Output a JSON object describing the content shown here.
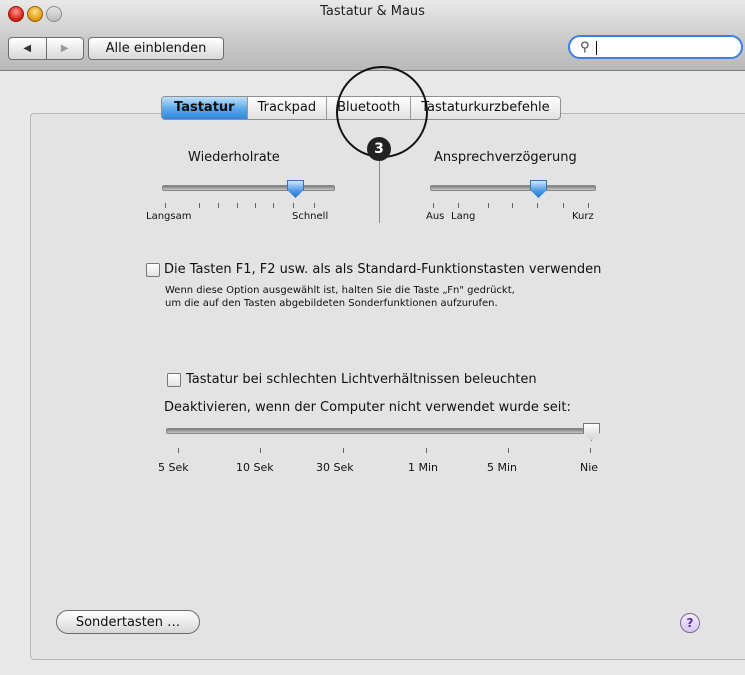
{
  "window": {
    "title": "Tastatur & Maus"
  },
  "toolbar": {
    "back_glyph": "◀",
    "forward_glyph": "▶",
    "show_all_label": "Alle einblenden",
    "search_icon_glyph": "⚲"
  },
  "tabs": [
    {
      "label": "Tastatur",
      "active": true
    },
    {
      "label": "Trackpad",
      "active": false
    },
    {
      "label": "Bluetooth",
      "active": false
    },
    {
      "label": "Tastaturkurzbefehle",
      "active": false
    }
  ],
  "keyboard": {
    "repeat_rate": {
      "title": "Wiederholrate",
      "min_label": "Langsam",
      "max_label": "Schnell"
    },
    "repeat_delay": {
      "title": "Ansprechverzögerung",
      "min_label": "Aus",
      "min_label2": "Lang",
      "max_label": "Kurz"
    },
    "fn_option": {
      "label": "Die Tasten F1, F2 usw. als als Standard-Funktionstasten verwenden",
      "help_line1": "Wenn diese Option ausgewählt ist, halten Sie die Taste „Fn\" gedrückt,",
      "help_line2": "um die auf den Tasten abgebildeten Sonderfunktionen aufzurufen.",
      "checked": false
    },
    "backlight": {
      "label": "Tastatur bei schlechten Lichtverhältnissen beleuchten",
      "checked": false,
      "deactivate_label": "Deaktivieren, wenn der Computer nicht verwendet wurde seit:",
      "times": [
        "5 Sek",
        "10 Sek",
        "30 Sek",
        "1 Min",
        "5 Min",
        "Nie"
      ],
      "selected": "Nie"
    }
  },
  "footer": {
    "special_keys_label": "Sondertasten …",
    "help_glyph": "?"
  },
  "annotation": {
    "badge": "3"
  }
}
